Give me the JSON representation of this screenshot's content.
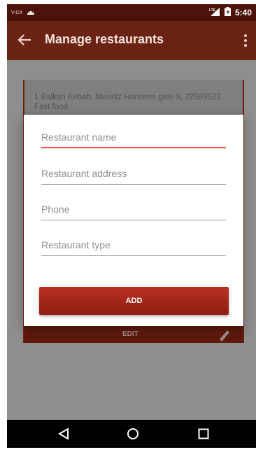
{
  "status_bar": {
    "carrier": "V:CA",
    "network": "LTE",
    "time": "5:40"
  },
  "app_bar": {
    "title": "Manage restaurants"
  },
  "background_card": {
    "text": "1 Balkan Kebab, Mauritz Hansens gate 5, 22599522, Fast food",
    "edit_label": "EDIT"
  },
  "dialog": {
    "fields": [
      {
        "placeholder": "Restaurant name"
      },
      {
        "placeholder": "Restaurant address"
      },
      {
        "placeholder": "Phone"
      },
      {
        "placeholder": "Restaurant type"
      }
    ],
    "add_label": "ADD"
  },
  "colors": {
    "accent": "#e4584a",
    "button": "#a8281a",
    "appbar": "#6a2312"
  }
}
